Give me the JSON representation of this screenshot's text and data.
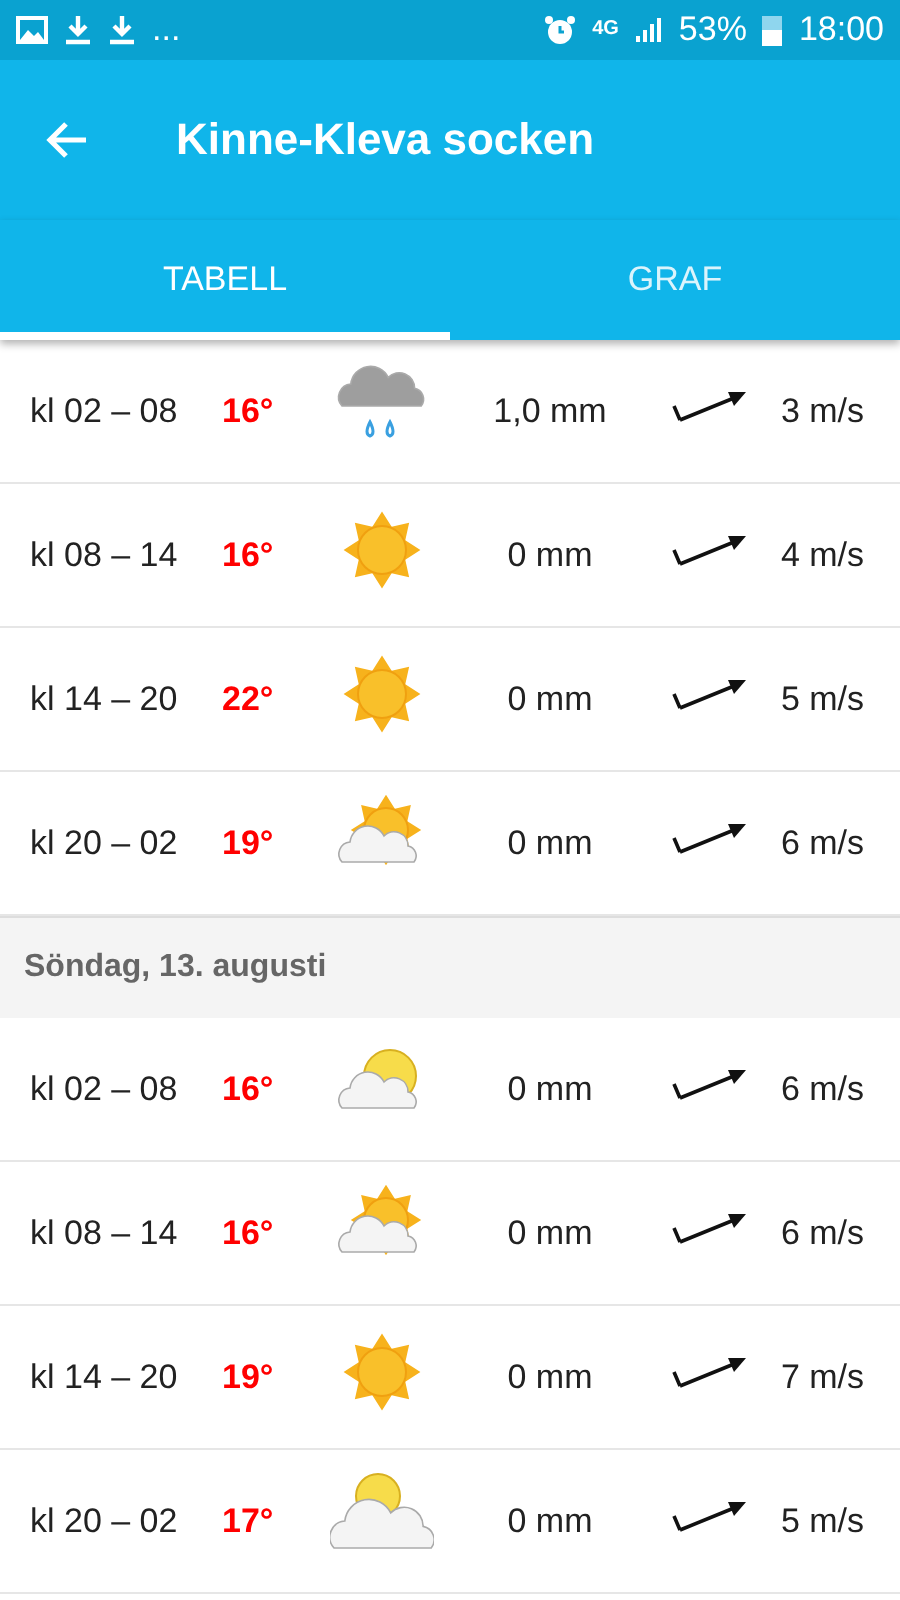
{
  "status_bar": {
    "overflow": "...",
    "network": "4G",
    "battery": "53%",
    "time": "18:00"
  },
  "app_bar": {
    "title": "Kinne-Kleva socken"
  },
  "tabs": [
    {
      "label": "TABELL",
      "selected": true
    },
    {
      "label": "GRAF",
      "selected": false
    }
  ],
  "sections": [
    {
      "rows": [
        {
          "time": "kl 02 – 08",
          "temp": "16°",
          "kind": "rain",
          "precip": "1,0 mm",
          "wind": "3 m/s"
        },
        {
          "time": "kl 08 – 14",
          "temp": "16°",
          "kind": "sun",
          "precip": "0 mm",
          "wind": "4 m/s"
        },
        {
          "time": "kl 14 – 20",
          "temp": "22°",
          "kind": "sun",
          "precip": "0 mm",
          "wind": "5 m/s"
        },
        {
          "time": "kl 20 – 02",
          "temp": "19°",
          "kind": "sun-cloud",
          "precip": "0 mm",
          "wind": "6 m/s"
        }
      ]
    },
    {
      "heading": "Söndag, 13. augusti",
      "rows": [
        {
          "time": "kl 02 – 08",
          "temp": "16°",
          "kind": "cloud-sun",
          "precip": "0 mm",
          "wind": "6 m/s"
        },
        {
          "time": "kl 08 – 14",
          "temp": "16°",
          "kind": "sun-cloud",
          "precip": "0 mm",
          "wind": "6 m/s"
        },
        {
          "time": "kl 14 – 20",
          "temp": "19°",
          "kind": "sun",
          "precip": "0 mm",
          "wind": "7 m/s"
        },
        {
          "time": "kl 20 – 02",
          "temp": "17°",
          "kind": "cloud-sun-big",
          "precip": "0 mm",
          "wind": "5 m/s"
        }
      ]
    }
  ]
}
